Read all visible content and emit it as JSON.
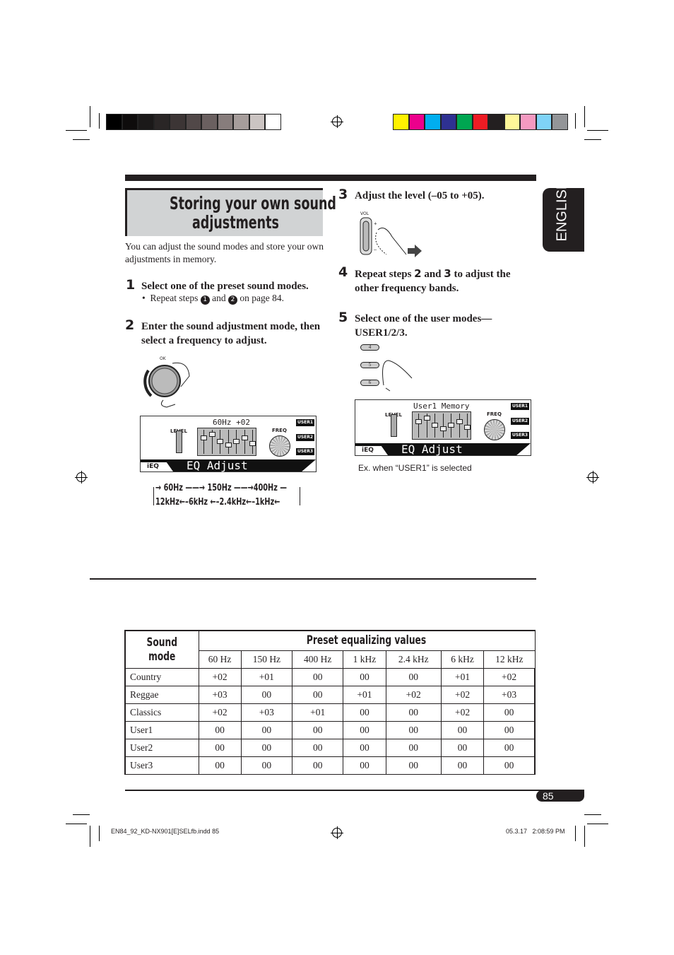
{
  "colors": {
    "gray_bar": [
      "#000000",
      "#0e0c0c",
      "#1b1919",
      "#2a2626",
      "#3c3535",
      "#514848",
      "#6a6060",
      "#877d7c",
      "#a69d9b",
      "#cbc4c2",
      "#ffffff"
    ],
    "color_bar": [
      "#fff200",
      "#ec008c",
      "#00aeef",
      "#2e3192",
      "#00a651",
      "#ed1c24",
      "#231f20",
      "#fff799",
      "#f49ac1",
      "#7fd3f7",
      "#939598"
    ]
  },
  "title": {
    "line1": "Storing your own sound",
    "line2": "adjustments"
  },
  "intro": "You can adjust the sound modes and store your own adjustments in memory.",
  "steps": [
    {
      "num": "1",
      "text": "Select one of the preset sound modes.",
      "bullet_pre": "Repeat steps",
      "bullet_mid": "and",
      "bullet_post": "on page 84.",
      "circled": [
        "1",
        "2"
      ]
    },
    {
      "num": "2",
      "text": "Enter the sound adjustment mode, then select a frequency to adjust.",
      "dial_label": "OK"
    },
    {
      "num": "3",
      "text": "Adjust the level (–05 to +05).",
      "vol_label": "VOL"
    },
    {
      "num": "4",
      "pre": "Repeat steps",
      "b1": "2",
      "mid": "and",
      "b2": "3",
      "post": "to adjust the other frequency bands."
    },
    {
      "num": "5",
      "text": "Select one of the user modes— USER1/2/3.",
      "buttons": [
        "4",
        "5",
        "6"
      ]
    }
  ],
  "display1": {
    "top": "60Hz +02",
    "level": "LEVEL",
    "freq": "FREQ",
    "users": [
      "USER1",
      "USER2",
      "USER3"
    ],
    "mode": "iEQ",
    "main": "EQ Adjust",
    "slider_levels": [
      1,
      2,
      0,
      -1,
      0,
      1,
      -0.5
    ]
  },
  "display2": {
    "top": "User1 Memory",
    "level": "LEVEL",
    "freq": "FREQ",
    "users": [
      "USER1",
      "USER2",
      "USER3"
    ],
    "mode": "iEQ",
    "main": "EQ Adjust",
    "slider_levels": [
      1,
      2,
      0,
      -1,
      0,
      1,
      -0.5
    ],
    "caption": "Ex. when “USER1” is selected"
  },
  "freq_cycle": {
    "top": [
      "60Hz",
      "150Hz",
      "400Hz"
    ],
    "bottom": [
      "12kHz",
      "6kHz",
      "2.4kHz",
      "1kHz"
    ]
  },
  "side_tab": "ENGLISH",
  "table": {
    "col_mode": "Sound mode",
    "col_group": "Preset equalizing values",
    "freqs": [
      "60 Hz",
      "150 Hz",
      "400 Hz",
      "1 kHz",
      "2.4 kHz",
      "6 kHz",
      "12 kHz"
    ],
    "rows": [
      {
        "mode": "Country",
        "values": [
          "+02",
          "+01",
          "00",
          "00",
          "00",
          "+01",
          "+02"
        ]
      },
      {
        "mode": "Reggae",
        "values": [
          "+03",
          "00",
          "00",
          "+01",
          "+02",
          "+02",
          "+03"
        ]
      },
      {
        "mode": "Classics",
        "values": [
          "+02",
          "+03",
          "+01",
          "00",
          "00",
          "+02",
          "00"
        ]
      },
      {
        "mode": "User1",
        "values": [
          "00",
          "00",
          "00",
          "00",
          "00",
          "00",
          "00"
        ]
      },
      {
        "mode": "User2",
        "values": [
          "00",
          "00",
          "00",
          "00",
          "00",
          "00",
          "00"
        ]
      },
      {
        "mode": "User3",
        "values": [
          "00",
          "00",
          "00",
          "00",
          "00",
          "00",
          "00"
        ]
      }
    ]
  },
  "page_number": "85",
  "footer": {
    "file": "EN84_92_KD-NX901[E]SELfb.indd   85",
    "date": "05.3.17   2:08:59 PM"
  }
}
